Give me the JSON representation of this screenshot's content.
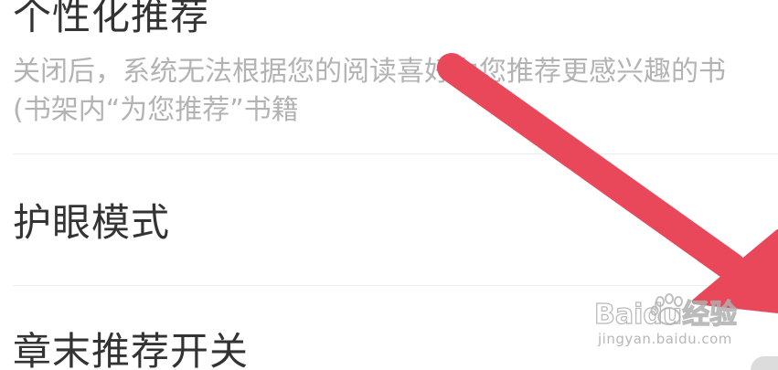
{
  "settings": {
    "personalized": {
      "title": "个性化推荐",
      "description": "关闭后，系统无法根据您的阅读喜好为您推荐更感兴趣的书(书架内“为您推荐”书籍"
    },
    "eye_care": {
      "title": "护眼模式"
    },
    "chapter_end": {
      "title": "章末推荐开关"
    }
  },
  "watermark": {
    "logo_text": "Baidu经验",
    "url_text": "jingyan.baidu.com"
  },
  "colors": {
    "arrow": "#e8485a",
    "title_text": "#333333",
    "desc_text": "#b3b3b3",
    "divider": "#ececec"
  },
  "icons": {
    "annotation": "arrow-pointer-icon",
    "watermark": "baidu-paw-icon"
  }
}
